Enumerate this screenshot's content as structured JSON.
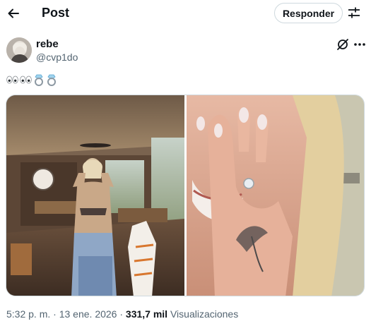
{
  "header": {
    "title": "Post",
    "reply_label": "Responder"
  },
  "author": {
    "display_name": "rebe",
    "handle": "@cvp1do"
  },
  "tweet": {
    "emoji_icons": [
      "eyes-emoji",
      "eyes-emoji",
      "ring-emoji",
      "ring-emoji"
    ]
  },
  "media": {
    "photos": [
      "photo-woman-in-room",
      "photo-hands-covering-face"
    ]
  },
  "meta": {
    "time": "5:32 p. m.",
    "separator_1": "·",
    "date": "13 ene. 2026",
    "separator_2": "·",
    "views_count": "331,7 mil",
    "views_label": "Visualizaciones"
  },
  "colors": {
    "text_primary": "#0f1419",
    "text_secondary": "#536471",
    "border": "#cfd9de",
    "background": "#ffffff"
  }
}
